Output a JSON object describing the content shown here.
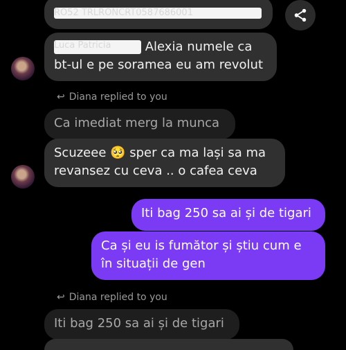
{
  "messages": {
    "m1": {
      "redacted_text": "RO52 TRLRONCRT0587686001"
    },
    "m2": {
      "redacted_name": "Luca Patricia",
      "text_line1": "Alexia  numele ca",
      "text_line2": "bt-ul e pe soramea eu am revolut"
    },
    "reply1": {
      "label": "Diana replied to you"
    },
    "q1": {
      "text": "Ca imediat merg la munca"
    },
    "m3": {
      "line1": "Scuzeee 🥺 sper ca ma lași sa ma",
      "line2": "revansez cu ceva .. o cafea ceva"
    },
    "out1": {
      "text": "Iti bag 250 sa ai și de tigari"
    },
    "out2": {
      "line1": "Ca și eu is fumător și știu cum e",
      "line2": "în situații de gen"
    },
    "reply2": {
      "label": "Diana replied to you"
    },
    "q2": {
      "text": "Iti bag 250 sa ai și de tigari"
    }
  },
  "icons": {
    "share": "share-icon",
    "reply": "reply-arrow-icon"
  },
  "colors": {
    "outgoing": "#7b3bf5",
    "incoming": "#303030",
    "quoted": "#1e1e1e",
    "background": "#000000"
  }
}
